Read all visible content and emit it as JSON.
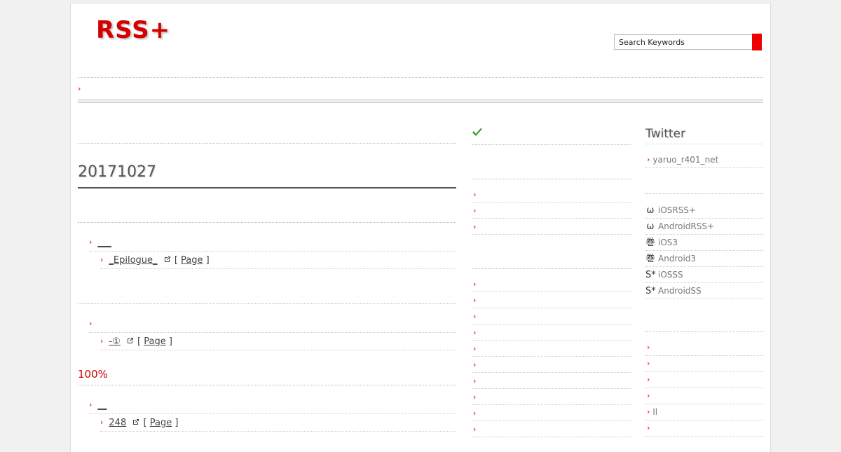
{
  "header": {
    "logo": "RSS+",
    "search_placeholder": "Search Keywords"
  },
  "main": {
    "date": "20171027",
    "articles": [
      {
        "title": "___",
        "sub": {
          "title": "_Epilogue_",
          "page_open": "[",
          "page_label": "Page",
          "page_close": "]"
        }
      },
      {
        "title": "",
        "sub": {
          "title": "-①",
          "page_open": "[",
          "page_label": "Page",
          "page_close": "]"
        }
      },
      {
        "heading": "100%",
        "title": "__",
        "sub": {
          "title": "248",
          "page_open": "[",
          "page_label": "Page",
          "page_close": "]"
        }
      }
    ]
  },
  "sidebar": {
    "twitter_title": "Twitter",
    "twitter_account": "yaruo_r401_net",
    "apps": [
      {
        "glyph": "ω",
        "label": "iOSRSS+"
      },
      {
        "glyph": "ω",
        "label": "AndroidRSS+"
      },
      {
        "glyph": "巻",
        "label": "iOS3"
      },
      {
        "glyph": "巻",
        "label": "Android3"
      },
      {
        "glyph": "S*",
        "label": "iOSSS"
      },
      {
        "glyph": "S*",
        "label": "AndroidSS"
      }
    ],
    "links_bottom": [
      "",
      "",
      "",
      "",
      "ll",
      "",
      ""
    ]
  },
  "colors": {
    "accent": "#d40000",
    "check": "#3a9a2a"
  }
}
